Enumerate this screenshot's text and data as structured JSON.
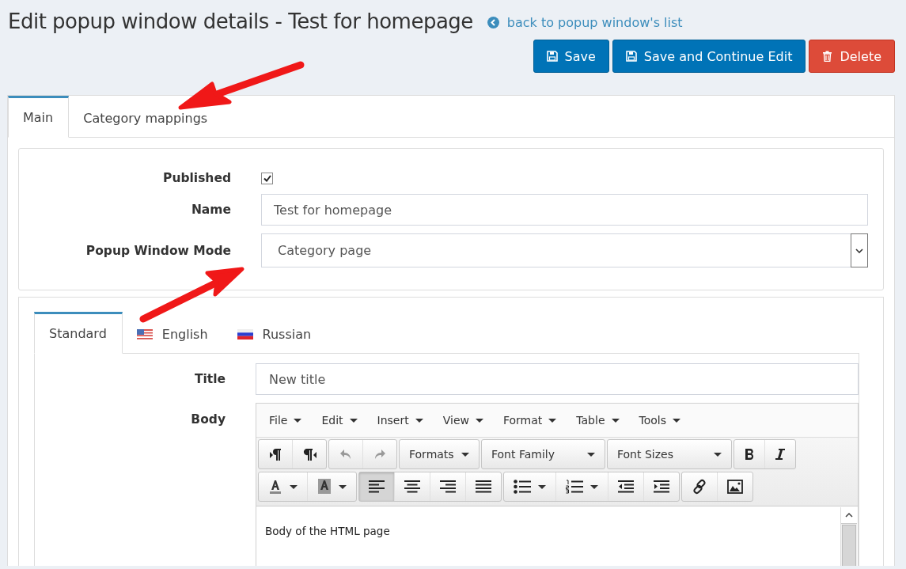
{
  "header": {
    "title": "Edit popup window details - Test for homepage",
    "back_link": "back to popup window's list"
  },
  "buttons": [
    {
      "label": "Save",
      "kind": "save"
    },
    {
      "label": "Save and Continue Edit",
      "kind": "save"
    },
    {
      "label": "Delete",
      "kind": "delete"
    }
  ],
  "tabs": [
    {
      "label": "Main",
      "selected": true
    },
    {
      "label": "Category mappings",
      "selected": false
    }
  ],
  "form": {
    "published": {
      "label": "Published",
      "checked": true
    },
    "name": {
      "label": "Name",
      "value": "Test for homepage"
    },
    "mode": {
      "label": "Popup Window Mode",
      "value": "Category page"
    }
  },
  "language_tabs": [
    {
      "label": "Standard",
      "kind": "plain",
      "selected": true
    },
    {
      "label": "English",
      "kind": "us",
      "selected": false
    },
    {
      "label": "Russian",
      "kind": "ru",
      "selected": false
    }
  ],
  "content": {
    "title": {
      "label": "Title",
      "value": "New title"
    },
    "body_label": "Body"
  },
  "editor": {
    "menu": [
      "File",
      "Edit",
      "Insert",
      "View",
      "Format",
      "Table",
      "Tools"
    ],
    "dropdowns": [
      "Formats",
      "Font Family",
      "Font Sizes"
    ],
    "alignment": [
      {
        "selected": true
      },
      {
        "selected": false
      },
      {
        "selected": false
      },
      {
        "selected": false
      }
    ],
    "body": "Body of the HTML page"
  }
}
